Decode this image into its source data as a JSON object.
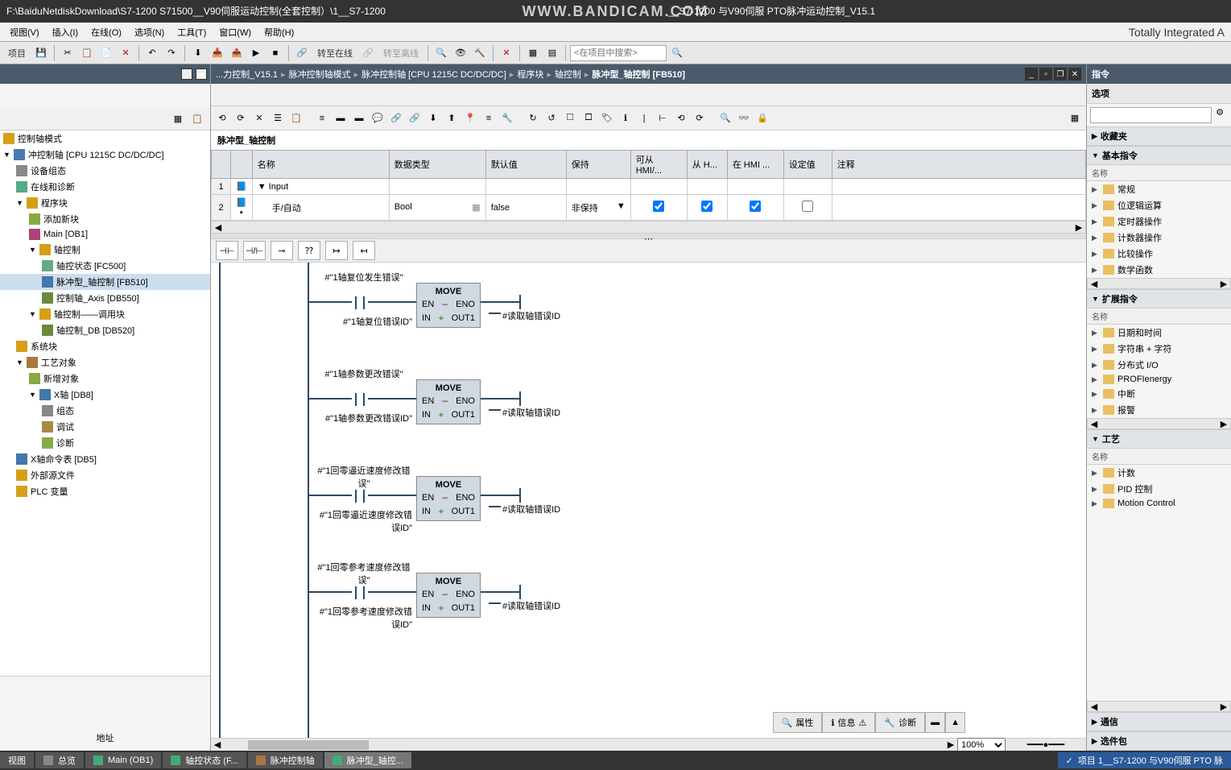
{
  "titlebar": {
    "path_left": "F:\\BaiduNetdiskDownload\\S7-1200 S71500__V90伺服运动控制(全套控制）\\1__S7-1200",
    "watermark": "WWW.BANDICAM.COM",
    "path_right": "__S7-1200 与V90伺服 PTO脉冲运动控制_V15.1"
  },
  "menu": {
    "items": [
      "视图(V)",
      "插入(I)",
      "在线(O)",
      "选项(N)",
      "工具(T)",
      "窗口(W)",
      "帮助(H)"
    ],
    "product": "Totally Integrated A"
  },
  "toolbar": {
    "project_label": "项目",
    "go_online": "转至在线",
    "go_offline": "转至离线",
    "search_placeholder": "<在项目中搜索>"
  },
  "tree": {
    "items": [
      {
        "label": "控制轴模式",
        "indent": 0,
        "icon": "folder"
      },
      {
        "label": "冲控制轴 [CPU 1215C DC/DC/DC]",
        "indent": 0,
        "icon": "cpu",
        "expand": "▼"
      },
      {
        "label": "设备组态",
        "indent": 1,
        "icon": "gear"
      },
      {
        "label": "在线和诊断",
        "indent": 1,
        "icon": "online"
      },
      {
        "label": "程序块",
        "indent": 1,
        "icon": "folder",
        "expand": "▼"
      },
      {
        "label": "添加新块",
        "indent": 2,
        "icon": "add"
      },
      {
        "label": "Main [OB1]",
        "indent": 2,
        "icon": "ob"
      },
      {
        "label": "轴控制",
        "indent": 2,
        "icon": "folder",
        "expand": "▼"
      },
      {
        "label": "轴控状态 [FC500]",
        "indent": 3,
        "icon": "fc"
      },
      {
        "label": "脉冲型_轴控制 [FB510]",
        "indent": 3,
        "icon": "fb",
        "selected": true
      },
      {
        "label": "控制轴_Axis [DB550]",
        "indent": 3,
        "icon": "db"
      },
      {
        "label": "轴控制——调用块",
        "indent": 2,
        "icon": "folder",
        "expand": "▼"
      },
      {
        "label": "轴控制_DB [DB520]",
        "indent": 3,
        "icon": "db"
      },
      {
        "label": "系统块",
        "indent": 1,
        "icon": "folder"
      },
      {
        "label": "工艺对象",
        "indent": 1,
        "icon": "tech",
        "expand": "▼"
      },
      {
        "label": "新增对象",
        "indent": 2,
        "icon": "add"
      },
      {
        "label": "X轴 [DB8]",
        "indent": 2,
        "icon": "axis",
        "expand": "▼"
      },
      {
        "label": "组态",
        "indent": 3,
        "icon": "config"
      },
      {
        "label": "调试",
        "indent": 3,
        "icon": "debug"
      },
      {
        "label": "诊断",
        "indent": 3,
        "icon": "diag"
      },
      {
        "label": "X轴命令表 [DB5]",
        "indent": 1,
        "icon": "table"
      },
      {
        "label": "外部源文件",
        "indent": 1,
        "icon": "folder"
      },
      {
        "label": "PLC 变量",
        "indent": 1,
        "icon": "folder"
      }
    ],
    "address_label": "地址"
  },
  "breadcrumb": {
    "items": [
      "...力控制_V15.1",
      "脉冲控制轴模式",
      "脉冲控制轴 [CPU 1215C DC/DC/DC]",
      "程序块",
      "轴控制",
      "脉冲型_轴控制 [FB510]"
    ]
  },
  "block": {
    "title": "脉冲型_轴控制",
    "columns": [
      "名称",
      "数据类型",
      "默认值",
      "保持",
      "可从 HMI/...",
      "从 H...",
      "在 HMI ...",
      "设定值",
      "注释"
    ],
    "rows": [
      {
        "num": "1",
        "name": "Input",
        "type": "",
        "default": "",
        "retain": "",
        "hmi1": "",
        "hmi2": "",
        "hmi3": "",
        "set": "",
        "comment": "",
        "expand": "▼"
      },
      {
        "num": "2",
        "name": "手/自动",
        "type": "Bool",
        "default": "false",
        "retain": "非保持",
        "hmi1": true,
        "hmi2": true,
        "hmi3": true,
        "set": false,
        "comment": ""
      }
    ]
  },
  "ladder": {
    "networks": [
      {
        "contact_label": "#\"1轴复位发生错误\"",
        "in_label": "#\"1轴复位错误ID\"",
        "out_label": "#读取轴错误ID",
        "box": "MOVE",
        "en": "EN",
        "eno": "ENO",
        "in": "IN",
        "out": "OUT1"
      },
      {
        "contact_label": "#\"1轴参数更改错误\"",
        "in_label": "#\"1轴参数更改错误ID\"",
        "out_label": "#读取轴错误ID",
        "box": "MOVE",
        "en": "EN",
        "eno": "ENO",
        "in": "IN",
        "out": "OUT1"
      },
      {
        "contact_label": "#\"1回零逼近速度修改错误\"",
        "in_label": "#\"1回零逼近速度修改错误ID\"",
        "out_label": "#读取轴错误ID",
        "box": "MOVE",
        "en": "EN",
        "eno": "ENO",
        "in": "IN",
        "out": "OUT1"
      },
      {
        "contact_label": "#\"1回零参考速度修改错误\"",
        "in_label": "#\"1回零参考速度修改错误ID\"",
        "out_label": "#读取轴错误ID",
        "box": "MOVE",
        "en": "EN",
        "eno": "ENO",
        "in": "IN",
        "out": "OUT1"
      }
    ],
    "zoom": "100%"
  },
  "right": {
    "title": "指令",
    "options": "选项",
    "favorites": "收藏夹",
    "basic": {
      "title": "基本指令",
      "col": "名称",
      "items": [
        "常规",
        "位逻辑运算",
        "定时器操作",
        "计数器操作",
        "比较操作",
        "数学函数"
      ]
    },
    "extended": {
      "title": "扩展指令",
      "col": "名称",
      "items": [
        "日期和时间",
        "字符串 + 字符",
        "分布式 I/O",
        "PROFIenergy",
        "中断",
        "报警"
      ]
    },
    "tech": {
      "title": "工艺",
      "col": "名称",
      "items": [
        "计数",
        "PID 控制",
        "Motion Control"
      ]
    },
    "comm": "通信",
    "optional": "选件包"
  },
  "status_tabs": {
    "properties": "属性",
    "info": "信息",
    "diag": "诊断"
  },
  "taskbar": {
    "items": [
      {
        "label": "视图",
        "icon": ""
      },
      {
        "label": "总览",
        "icon": "🗂"
      },
      {
        "label": "Main (OB1)",
        "icon": "📘"
      },
      {
        "label": "轴控状态 (F...",
        "icon": "📗"
      },
      {
        "label": "脉冲控制轴",
        "icon": "📙"
      },
      {
        "label": "脉冲型_轴控...",
        "icon": "📘",
        "active": true
      }
    ],
    "status": "项目 1__S7-1200 与V90伺服 PTO 脉"
  }
}
